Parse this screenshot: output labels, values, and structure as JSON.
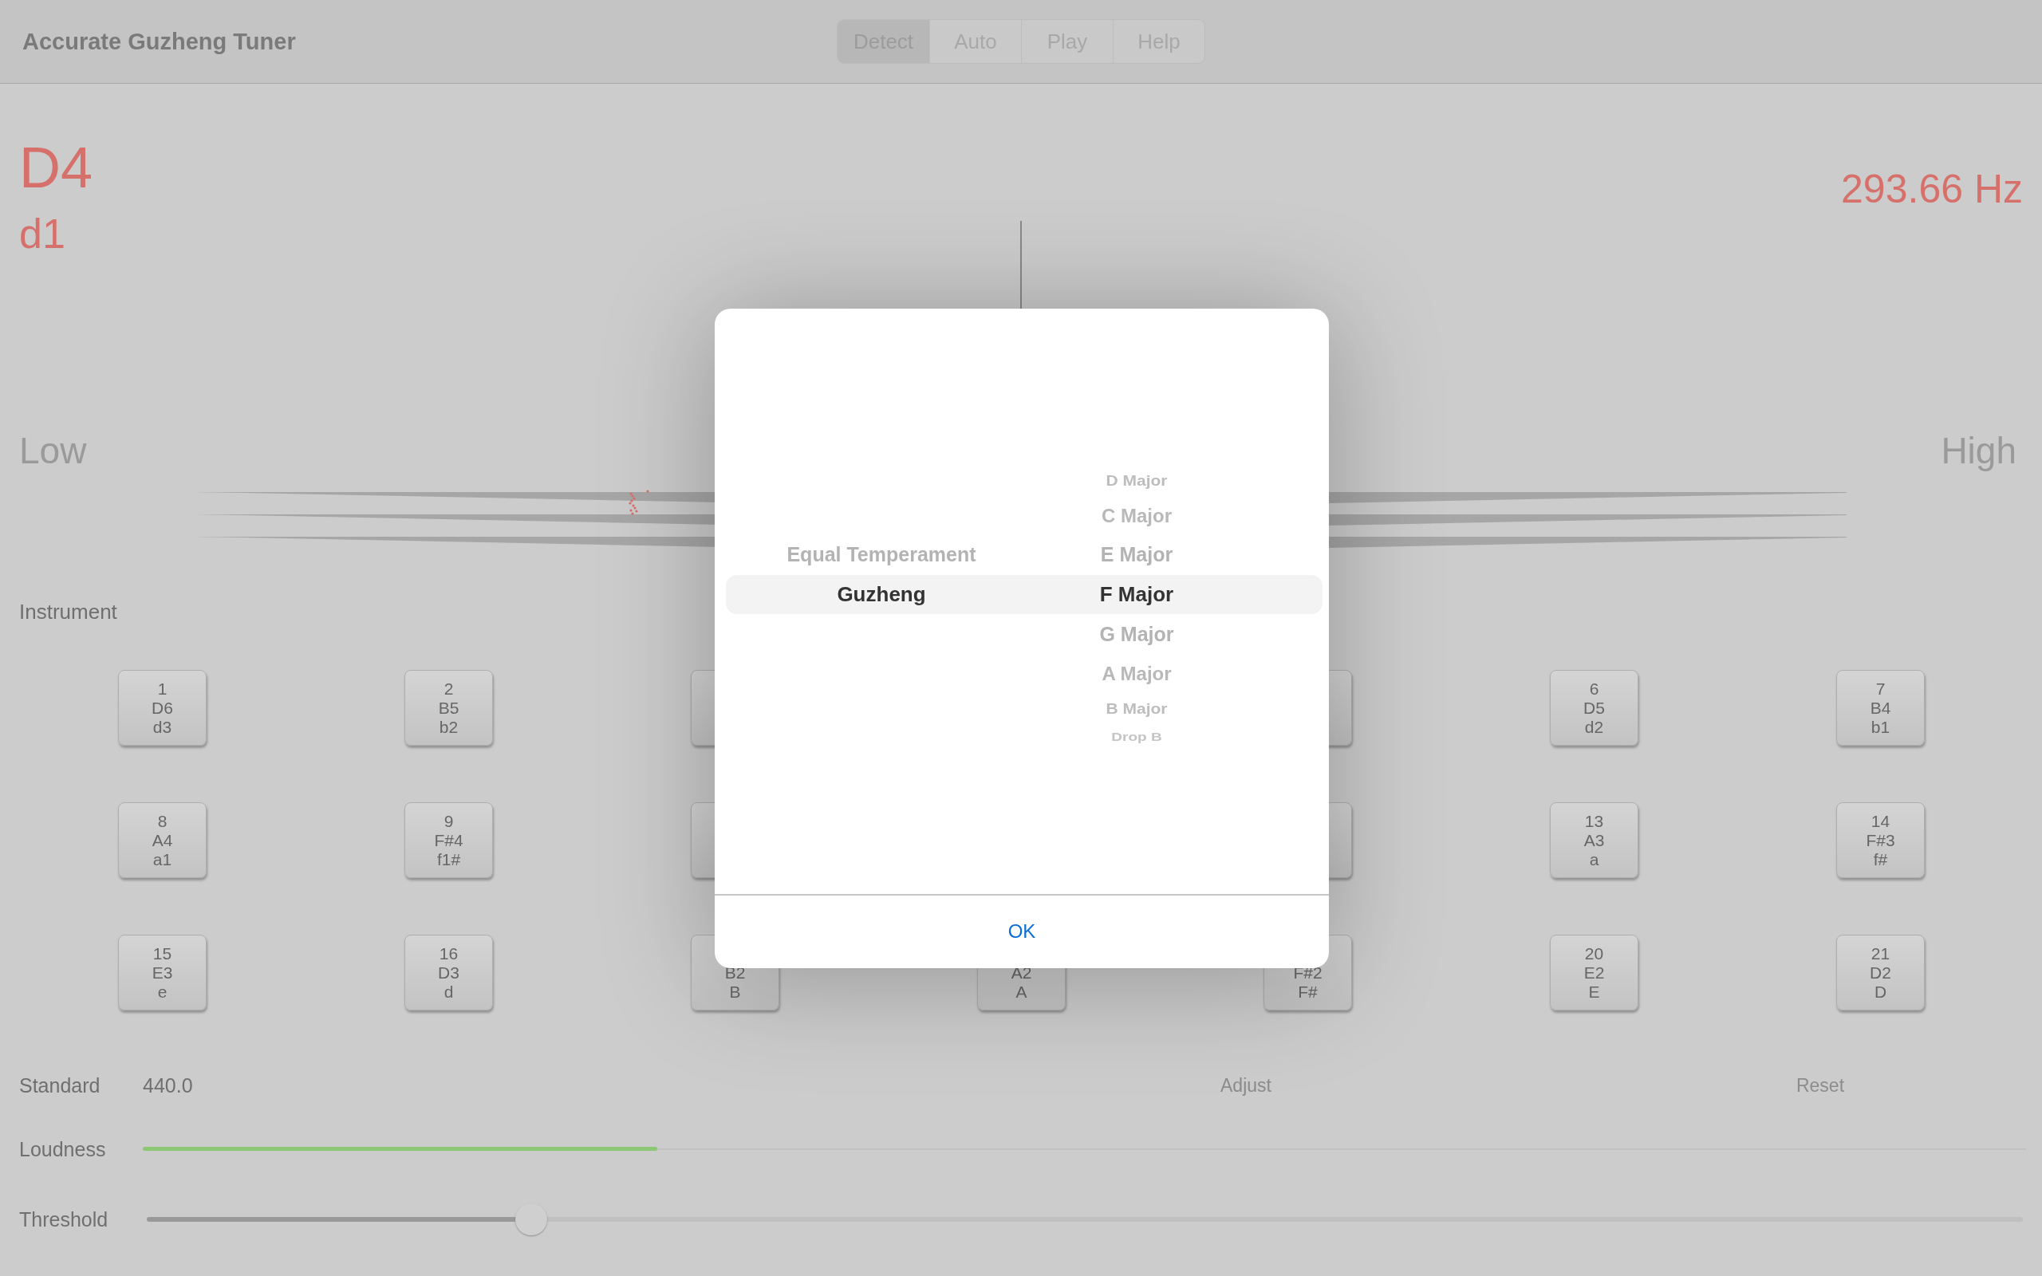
{
  "app": {
    "title": "Accurate Guzheng Tuner"
  },
  "tabs": [
    {
      "label": "Detect",
      "selected": true
    },
    {
      "label": "Auto",
      "selected": false
    },
    {
      "label": "Play",
      "selected": false
    },
    {
      "label": "Help",
      "selected": false
    }
  ],
  "readout": {
    "note": "D4",
    "solfa": "d1",
    "frequency": "293.66 Hz"
  },
  "meter": {
    "low_label": "Low",
    "high_label": "High"
  },
  "instrument": {
    "label": "Instrument",
    "key_rows": [
      {
        "keys": [
          {
            "kind": "key",
            "number": "1",
            "note": "D6",
            "solfa": "d3"
          },
          {
            "kind": "key",
            "number": "2",
            "note": "B5",
            "solfa": "b2"
          },
          {
            "kind": "key"
          },
          {
            "kind": "hidden"
          },
          {
            "kind": "key"
          },
          {
            "kind": "key",
            "number": "6",
            "note": "D5",
            "solfa": "d2"
          },
          {
            "kind": "key",
            "number": "7",
            "note": "B4",
            "solfa": "b1"
          }
        ]
      },
      {
        "keys": [
          {
            "kind": "key",
            "number": "8",
            "note": "A4",
            "solfa": "a1"
          },
          {
            "kind": "key",
            "number": "9",
            "note": "F#4",
            "solfa": "f1#"
          },
          {
            "kind": "key"
          },
          {
            "kind": "hidden"
          },
          {
            "kind": "key"
          },
          {
            "kind": "key",
            "number": "13",
            "note": "A3",
            "solfa": "a"
          },
          {
            "kind": "key",
            "number": "14",
            "note": "F#3",
            "solfa": "f#"
          }
        ]
      },
      {
        "keys": [
          {
            "kind": "key",
            "number": "15",
            "note": "E3",
            "solfa": "e"
          },
          {
            "kind": "key",
            "number": "16",
            "note": "D3",
            "solfa": "d"
          },
          {
            "kind": "key",
            "note": "B2",
            "solfa": "B"
          },
          {
            "kind": "key",
            "note": "A2",
            "solfa": "A"
          },
          {
            "kind": "key",
            "note": "F#2",
            "solfa": "F#"
          },
          {
            "kind": "key",
            "number": "20",
            "note": "E2",
            "solfa": "E"
          },
          {
            "kind": "key",
            "number": "21",
            "note": "D2",
            "solfa": "D"
          }
        ]
      }
    ]
  },
  "settings": {
    "standard_label": "Standard",
    "standard_value": "440.0",
    "adjust": "Adjust",
    "reset": "Reset",
    "loudness": {
      "label": "Loudness",
      "level": 0.273
    },
    "threshold": {
      "label": "Threshold",
      "level": 0.205
    }
  },
  "dialog": {
    "columns": [
      {
        "items": [
          {
            "label": "Equal Temperament",
            "selected": false
          },
          {
            "label": "Guzheng",
            "selected": true
          }
        ]
      },
      {
        "items": [
          {
            "label": "D Major",
            "selected": false
          },
          {
            "label": "C Major",
            "selected": false
          },
          {
            "label": "E Major",
            "selected": false
          },
          {
            "label": "F Major",
            "selected": true
          },
          {
            "label": "G Major",
            "selected": false
          },
          {
            "label": "A Major",
            "selected": false
          },
          {
            "label": "B Major",
            "selected": false
          },
          {
            "label": "Drop B",
            "selected": false
          }
        ]
      }
    ],
    "ok": "OK"
  }
}
